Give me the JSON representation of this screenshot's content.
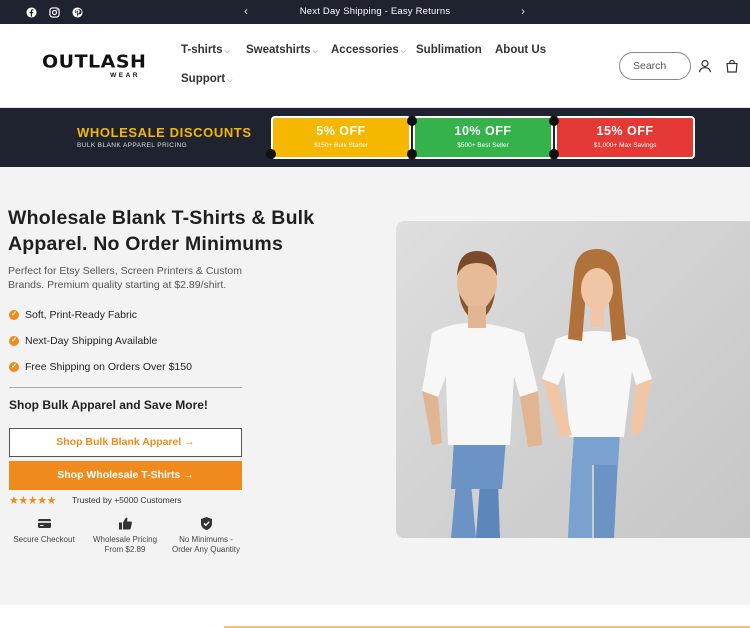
{
  "announcement": {
    "message": "Next Day Shipping - Easy Returns",
    "prev_icon": "‹",
    "next_icon": "›",
    "socials": [
      "facebook-icon",
      "instagram-icon",
      "pinterest-icon"
    ]
  },
  "header": {
    "logo_main": "OUTLASH",
    "logo_sub": "WEAR",
    "nav": [
      {
        "label": "T-shirts",
        "has_dropdown": true
      },
      {
        "label": "Sweatshirts",
        "has_dropdown": true
      },
      {
        "label": "Accessories",
        "has_dropdown": true
      },
      {
        "label": "Sublimation",
        "has_dropdown": false
      },
      {
        "label": "About Us",
        "has_dropdown": false
      },
      {
        "label": "Support",
        "has_dropdown": true
      }
    ],
    "caret": "⌵",
    "search_placeholder": "Search",
    "icons": [
      "account-icon",
      "cart-icon"
    ]
  },
  "promo": {
    "title": "WHOLESALE DISCOUNTS",
    "subtitle": "BULK BLANK APPAREL PRICING",
    "tiers": [
      {
        "off": "5% OFF",
        "condition": "$150+ Bulk Starter",
        "color": "#f6b700"
      },
      {
        "off": "10% OFF",
        "condition": "$500+ Best Seller",
        "color": "#35b24a"
      },
      {
        "off": "15% OFF",
        "condition": "$1,000+ Max Savings",
        "color": "#e53935"
      }
    ]
  },
  "hero": {
    "title": "Wholesale Blank T-Shirts & Bulk Apparel. No Order Minimums",
    "subtitle": "Perfect for Etsy Sellers, Screen Printers & Custom Brands. Premium quality starting at $2.89/shirt.",
    "features": [
      "Soft, Print-Ready Fabric",
      "Next-Day Shipping Available",
      "Free Shipping on Orders Over $150"
    ],
    "shop_heading": "Shop Bulk Apparel and Save More!",
    "button_primary": "Shop Bulk Blank Apparel  →",
    "button_secondary": "Shop Wholesale T-Shirts  →",
    "rating_stars": "★★★★★",
    "rating_value": 5,
    "trusted_text": "Trusted by +5000 Customers",
    "badges": [
      {
        "icon": "credit-card-icon",
        "line1": "Secure Checkout",
        "line2": ""
      },
      {
        "icon": "thumbs-up-icon",
        "line1": "Wholesale Pricing",
        "line2": "From $2.89"
      },
      {
        "icon": "shield-check-icon",
        "line1": "No Minimums -",
        "line2": "Order Any Quantity"
      }
    ]
  },
  "colors": {
    "dark": "#1f2330",
    "accent": "#ef8b1d",
    "gold": "#f5b800"
  }
}
